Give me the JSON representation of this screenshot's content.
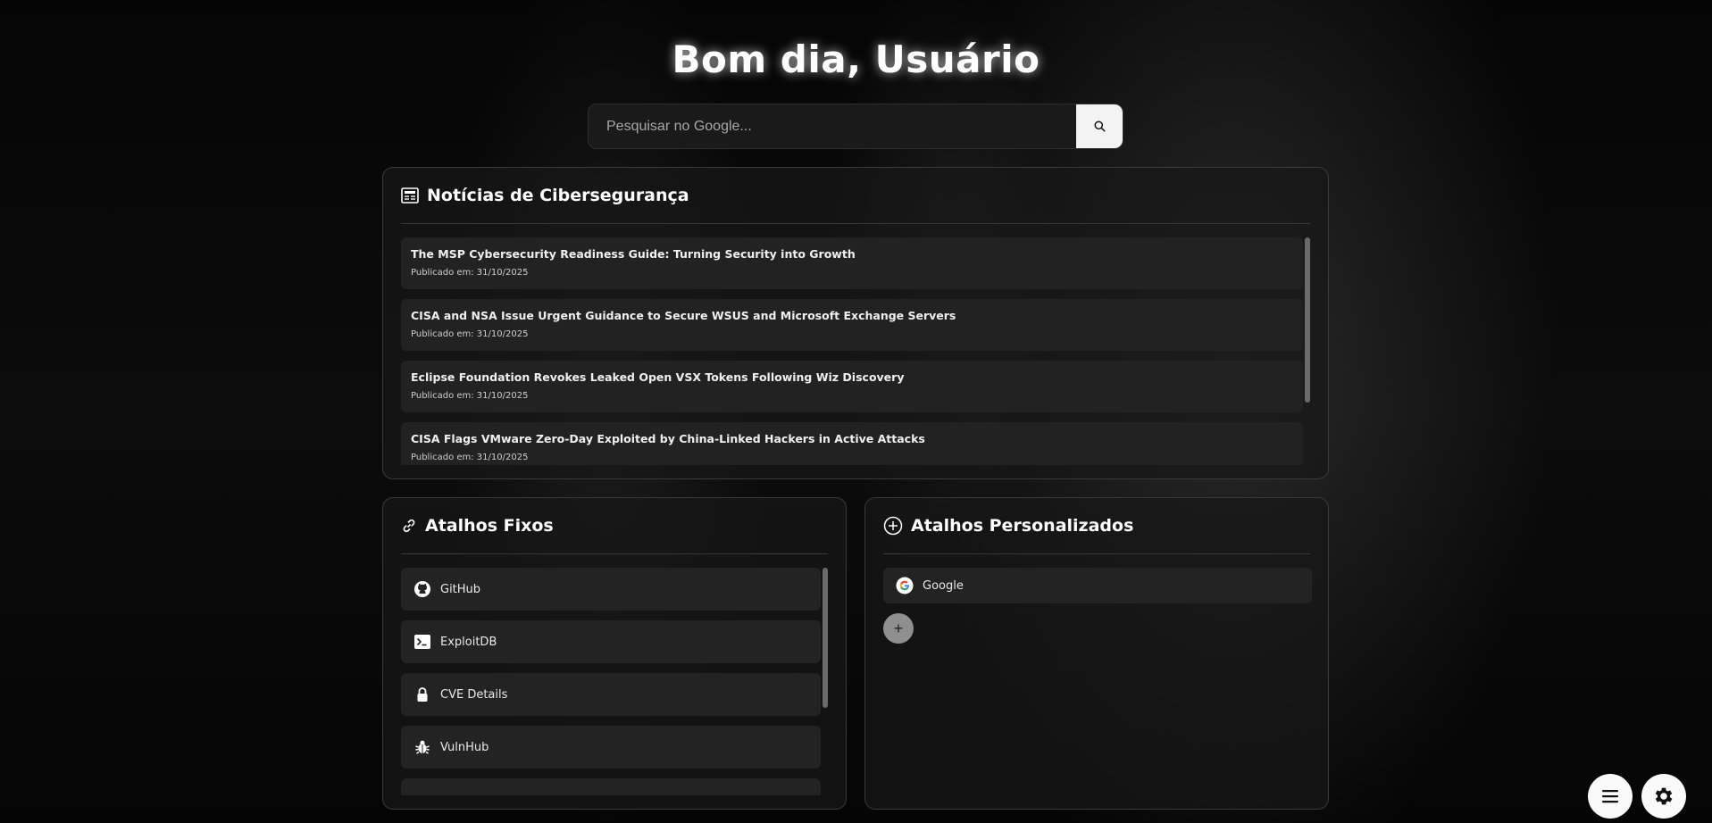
{
  "greeting": "Bom dia, Usuário",
  "search": {
    "placeholder": "Pesquisar no Google...",
    "button_icon": "search-icon"
  },
  "news": {
    "title": "Notícias de Cibersegurança",
    "icon": "newspaper-icon",
    "items": [
      {
        "title": "The MSP Cybersecurity Readiness Guide: Turning Security into Growth",
        "date": "Publicado em: 31/10/2025"
      },
      {
        "title": "CISA and NSA Issue Urgent Guidance to Secure WSUS and Microsoft Exchange Servers",
        "date": "Publicado em: 31/10/2025"
      },
      {
        "title": "Eclipse Foundation Revokes Leaked Open VSX Tokens Following Wiz Discovery",
        "date": "Publicado em: 31/10/2025"
      },
      {
        "title": "CISA Flags VMware Zero-Day Exploited by China-Linked Hackers in Active Attacks",
        "date": "Publicado em: 31/10/2025"
      }
    ]
  },
  "fixed_shortcuts": {
    "title": "Atalhos Fixos",
    "icon": "link-icon",
    "items": [
      {
        "label": "GitHub",
        "icon": "github-icon"
      },
      {
        "label": "ExploitDB",
        "icon": "terminal-icon"
      },
      {
        "label": "CVE Details",
        "icon": "lock-icon"
      },
      {
        "label": "VulnHub",
        "icon": "bug-icon"
      }
    ]
  },
  "custom_shortcuts": {
    "title": "Atalhos Personalizados",
    "icon": "plus-circle-icon",
    "items": [
      {
        "label": "Google",
        "icon": "google-icon"
      }
    ],
    "add_label": "+"
  },
  "fabs": {
    "menu_icon": "menu-icon",
    "settings_icon": "gear-icon"
  }
}
